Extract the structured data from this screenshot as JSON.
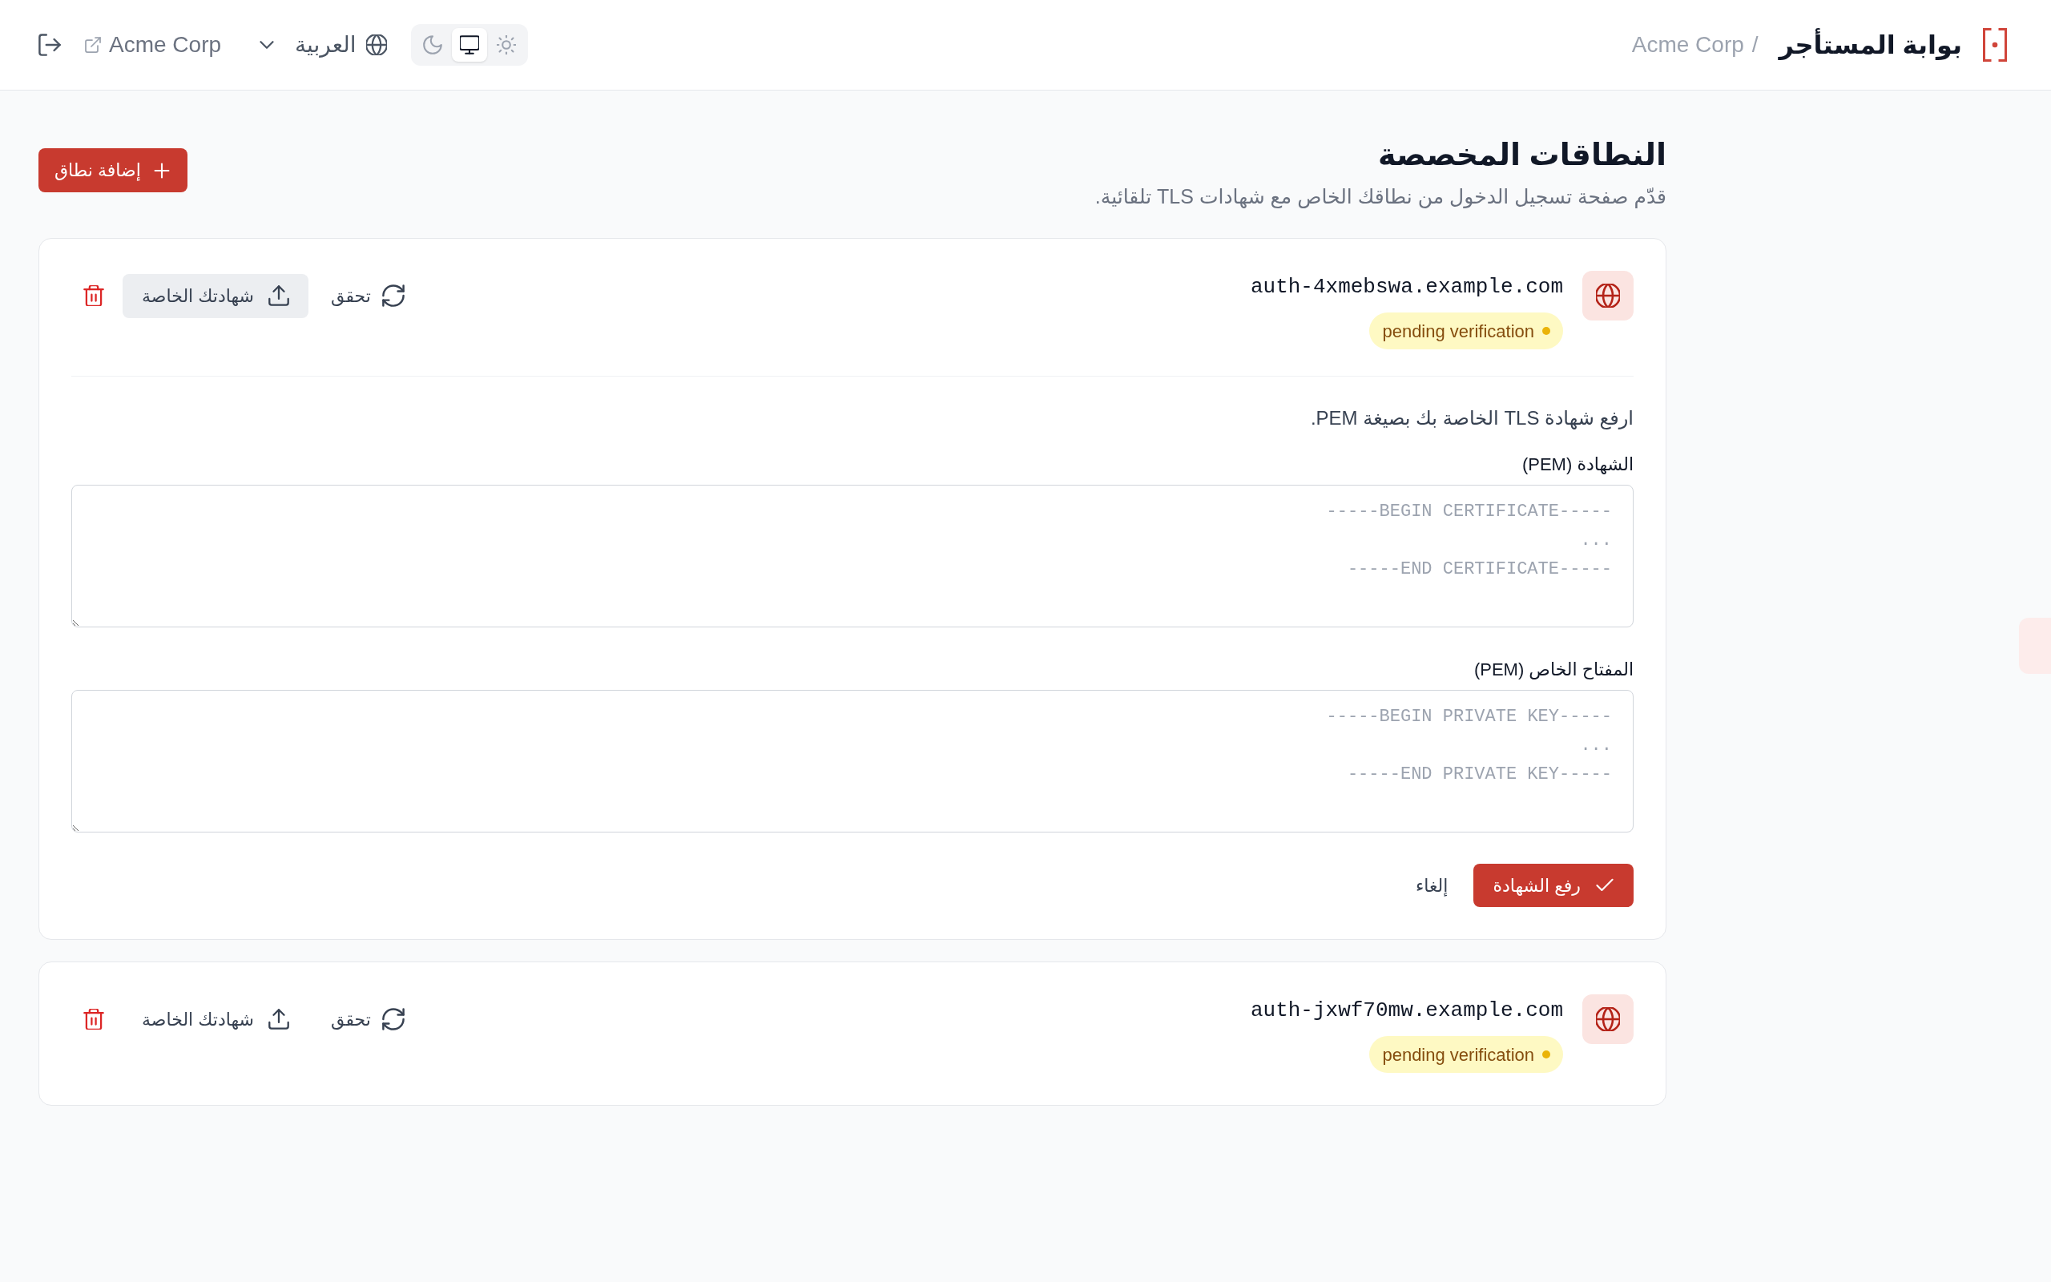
{
  "header": {
    "logo_title": "بوابة المستأجر",
    "breadcrumb_separator": "/",
    "tenant_name": "Acme Corp",
    "theme_options": [
      {
        "kind": "light",
        "selected": false
      },
      {
        "kind": "system",
        "selected": true
      },
      {
        "kind": "dark",
        "selected": false
      }
    ],
    "language": "العربية",
    "tenant_link": "Acme Corp"
  },
  "page": {
    "title": "النطاقات المخصصة",
    "subtitle": "قدّم صفحة تسجيل الدخول من نطاقك الخاص مع شهادات TLS تلقائية.",
    "add_button": "إضافة نطاق"
  },
  "domains": [
    {
      "name": "auth-4xmebswa.example.com",
      "status": "pending verification",
      "verify_button": "تحقق",
      "certificate_button": "شهادتك الخاصة",
      "expanded": true,
      "upload_form": {
        "hint": "ارفع شهادة TLS الخاصة بك بصيغة PEM.",
        "fields": [
          {
            "label": "الشهادة (PEM)",
            "placeholder": "-----BEGIN CERTIFICATE-----\n...\n-----END CERTIFICATE-----"
          },
          {
            "label": "المفتاح الخاص (PEM)",
            "placeholder": "-----BEGIN PRIVATE KEY-----\n...\n-----END PRIVATE KEY-----"
          }
        ],
        "submit_button": "رفع الشهادة",
        "cancel_button": "إلغاء"
      }
    },
    {
      "name": "auth-jxwf70mw.example.com",
      "status": "pending verification",
      "verify_button": "تحقق",
      "certificate_button": "شهادتك الخاصة",
      "expanded": false
    }
  ]
}
